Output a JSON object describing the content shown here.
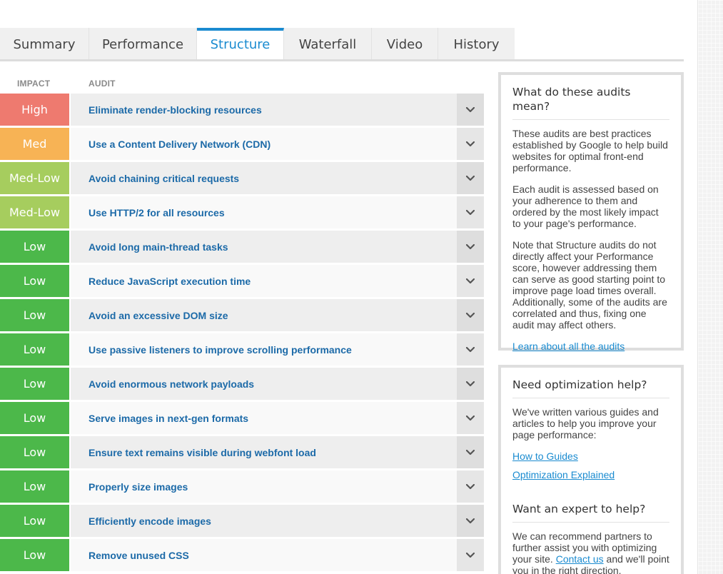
{
  "tabs": [
    {
      "label": "Summary",
      "active": false
    },
    {
      "label": "Performance",
      "active": false
    },
    {
      "label": "Structure",
      "active": true
    },
    {
      "label": "Waterfall",
      "active": false
    },
    {
      "label": "Video",
      "active": false
    },
    {
      "label": "History",
      "active": false
    }
  ],
  "columns": {
    "impact": "IMPACT",
    "audit": "AUDIT"
  },
  "impact_colors": {
    "High": "#ee7a6f",
    "Med": "#f7b355",
    "Med-Low": "#a6cd5e",
    "Low": "#4cb84a"
  },
  "audits": [
    {
      "impact": "High",
      "title": "Eliminate render-blocking resources"
    },
    {
      "impact": "Med",
      "title": "Use a Content Delivery Network (CDN)"
    },
    {
      "impact": "Med-Low",
      "title": "Avoid chaining critical requests"
    },
    {
      "impact": "Med-Low",
      "title": "Use HTTP/2 for all resources"
    },
    {
      "impact": "Low",
      "title": "Avoid long main-thread tasks"
    },
    {
      "impact": "Low",
      "title": "Reduce JavaScript execution time"
    },
    {
      "impact": "Low",
      "title": "Avoid an excessive DOM size"
    },
    {
      "impact": "Low",
      "title": "Use passive listeners to improve scrolling performance"
    },
    {
      "impact": "Low",
      "title": "Avoid enormous network payloads"
    },
    {
      "impact": "Low",
      "title": "Serve images in next-gen formats"
    },
    {
      "impact": "Low",
      "title": "Ensure text remains visible during webfont load"
    },
    {
      "impact": "Low",
      "title": "Properly size images"
    },
    {
      "impact": "Low",
      "title": "Efficiently encode images"
    },
    {
      "impact": "Low",
      "title": "Remove unused CSS"
    }
  ],
  "panel_about": {
    "title": "What do these audits mean?",
    "p1": "These audits are best practices established by Google to help build websites for optimal front-end performance.",
    "p2": "Each audit is assessed based on your adherence to them and ordered by the most likely impact to your page's performance.",
    "p3": "Note that Structure audits do not directly affect your Performance score, however addressing them can serve as good starting point to improve page load times overall. Additionally, some of the audits are correlated and thus, fixing one audit may affect others.",
    "link": "Learn about all the audits"
  },
  "panel_help": {
    "title": "Need optimization help?",
    "p1": "We've written various guides and articles to help you improve your page performance:",
    "link1": "How to Guides",
    "link2": "Optimization Explained",
    "title2": "Want an expert to help?",
    "p2_before": "We can recommend partners to further assist you with optimizing your site.",
    "p2_link": "Contact us",
    "p2_after": "and we'll point you in the right direction."
  },
  "icons": {
    "expand": "chevron-down-icon"
  }
}
